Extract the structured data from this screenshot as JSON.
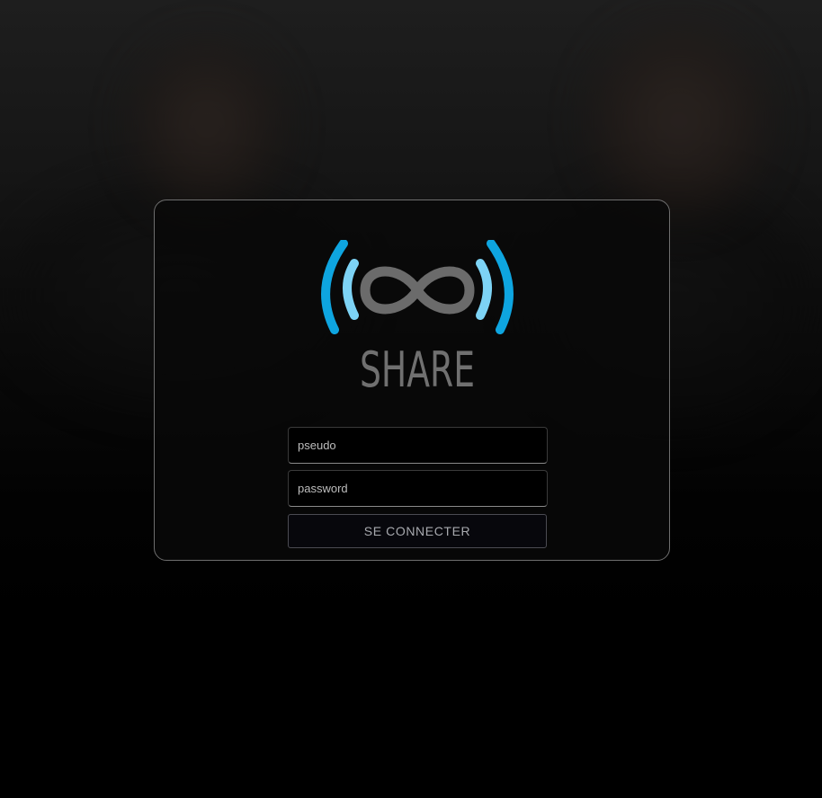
{
  "logo": {
    "icon": "infinity-broadcast-logo-icon",
    "wordmark": "SHARE",
    "colors": {
      "outer_wave": "#0ea5e0",
      "inner_wave": "#7dd3f5",
      "infinity": "#6b6b6b",
      "wordmark": "#707070"
    }
  },
  "form": {
    "username_placeholder": "pseudo",
    "password_placeholder": "password",
    "submit_label": "SE CONNECTER"
  }
}
